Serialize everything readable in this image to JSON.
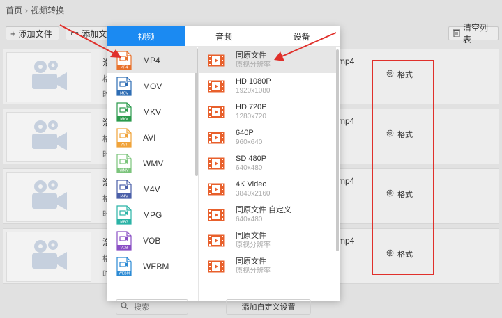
{
  "breadcrumb": {
    "home": "首页",
    "separator": "›",
    "current": "视频转换"
  },
  "toolbar": {
    "add_file": "添加文件",
    "add_folder": "添加文",
    "clear_list": "清空列表"
  },
  "rows": [
    {
      "name": "浩",
      "sub1": "格",
      "sub2": "时",
      "target": "mp4",
      "format_label": "格式"
    },
    {
      "name": "浩",
      "sub1": "格",
      "sub2": "时",
      "target": "mp4",
      "format_label": "格式"
    },
    {
      "name": "浩",
      "sub1": "格",
      "sub2": "时",
      "target": "mp4",
      "format_label": "格式"
    },
    {
      "name": "浩",
      "sub1": "格",
      "sub2": "时",
      "target": "mp4",
      "format_label": "格式"
    }
  ],
  "popup": {
    "tabs": [
      {
        "label": "视频",
        "active": true
      },
      {
        "label": "音频",
        "active": false
      },
      {
        "label": "设备",
        "active": false
      }
    ],
    "categories": [
      {
        "label": "MP4",
        "badge": "MP4",
        "color": "#e8712b",
        "selected": true
      },
      {
        "label": "MOV",
        "badge": "MOV",
        "color": "#2e6db4",
        "selected": false
      },
      {
        "label": "MKV",
        "badge": "MKV",
        "color": "#2b9a4c",
        "selected": false
      },
      {
        "label": "AVI",
        "badge": "AVI",
        "color": "#f0a33a",
        "selected": false
      },
      {
        "label": "WMV",
        "badge": "WMV",
        "color": "#7cc47c",
        "selected": false
      },
      {
        "label": "M4V",
        "badge": "M4V",
        "color": "#4a5fa8",
        "selected": false
      },
      {
        "label": "MPG",
        "badge": "MPG",
        "color": "#2bb3a6",
        "selected": false
      },
      {
        "label": "VOB",
        "badge": "VOB",
        "color": "#8a4fc4",
        "selected": false
      },
      {
        "label": "WEBM",
        "badge": "WEBM",
        "color": "#2b8ad4",
        "selected": false
      }
    ],
    "search_placeholder": "搜索",
    "presets": [
      {
        "title": "同原文件",
        "sub": "原视分辨率",
        "selected": true
      },
      {
        "title": "HD 1080P",
        "sub": "1920x1080",
        "selected": false
      },
      {
        "title": "HD 720P",
        "sub": "1280x720",
        "selected": false
      },
      {
        "title": "640P",
        "sub": "960x640",
        "selected": false
      },
      {
        "title": "SD 480P",
        "sub": "640x480",
        "selected": false
      },
      {
        "title": "4K Video",
        "sub": "3840x2160",
        "selected": false
      },
      {
        "title": "同原文件 自定义",
        "sub": "640x480",
        "selected": false
      },
      {
        "title": "同原文件",
        "sub": "原视分辨率",
        "selected": false
      },
      {
        "title": "同原文件",
        "sub": "原视分辨率",
        "selected": false
      }
    ],
    "add_custom": "添加自定义设置"
  },
  "colors": {
    "accent": "#1b8af2",
    "film_icon": "#e8602c",
    "annotation": "#e0302b"
  }
}
